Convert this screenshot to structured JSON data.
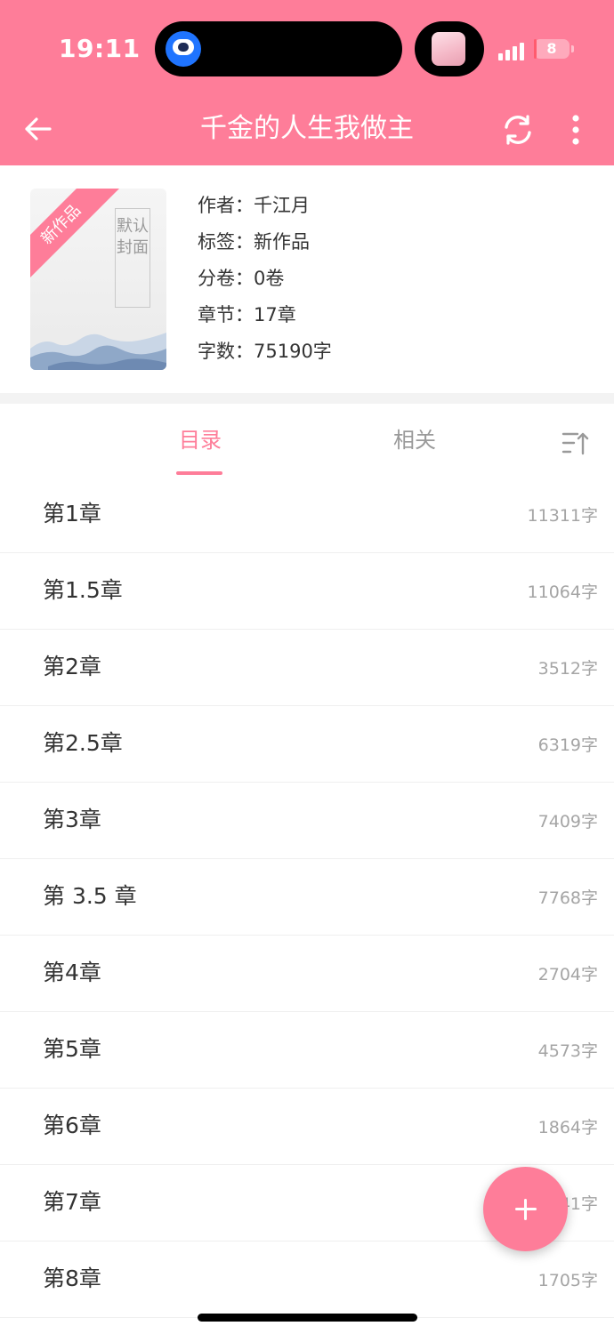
{
  "status_bar": {
    "time": "19:11",
    "battery_level": "8",
    "icons": [
      "app-assistant-icon",
      "signal-icon",
      "battery-icon"
    ]
  },
  "app_bar": {
    "title": "千金的人生我做主",
    "icons": [
      "back-arrow-icon",
      "refresh-icon",
      "more-vertical-icon"
    ]
  },
  "book": {
    "cover_badge": "新作品",
    "cover_text": "默认封面",
    "author": "作者：千江月",
    "tags": "标签：新作品",
    "volumes": "分卷：0卷",
    "chapters": "章节：17章",
    "word_count": "字数：75190字"
  },
  "tabs": {
    "catalog": "目录",
    "related": "相关",
    "active": "目录",
    "sort_icon": "sort-icon"
  },
  "chapter_list": [
    {
      "title": "第1章",
      "count": "11311字"
    },
    {
      "title": "第1.5章",
      "count": "11064字"
    },
    {
      "title": "第2章",
      "count": "3512字"
    },
    {
      "title": "第2.5章",
      "count": "6319字"
    },
    {
      "title": "第3章",
      "count": "7409字"
    },
    {
      "title": "第 3.5 章",
      "count": "7768字"
    },
    {
      "title": "第4章",
      "count": "2704字"
    },
    {
      "title": "第5章",
      "count": "4573字"
    },
    {
      "title": "第6章",
      "count": "1864字"
    },
    {
      "title": "第7章",
      "count": "41字"
    },
    {
      "title": "第8章",
      "count": "1705字"
    }
  ],
  "fab": {
    "icon": "plus-icon"
  },
  "colors": {
    "accent": "#fe7d99",
    "text_primary": "#333333",
    "text_secondary": "#a5a5a5",
    "battery_low": "#ff5b6e"
  }
}
